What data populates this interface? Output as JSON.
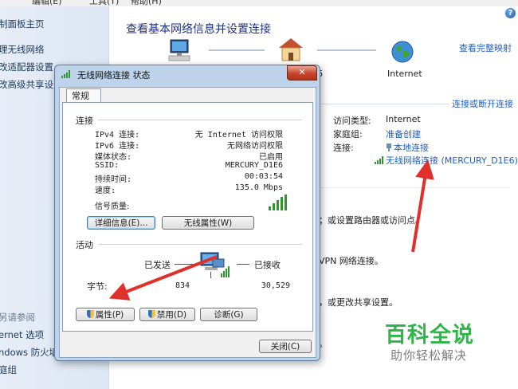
{
  "menubar": {
    "items": [
      "编辑(E)",
      "工具(T)",
      "帮助(H)"
    ]
  },
  "sidebar": {
    "items": [
      "制面板主页",
      "理无线网络",
      "改适配器设置",
      "改高级共享设置"
    ],
    "see_also_title": "另请参阅",
    "see_also": [
      "ernet 选项",
      "ndows 防火墙",
      "庭组"
    ]
  },
  "main": {
    "title": "查看基本网络信息并设置连接",
    "full_map": "查看完整映射",
    "internet_label": "Internet",
    "ipv6_fragment": "6",
    "connect_disconnect": "连接或断开连接",
    "access_type_label": "访问类型:",
    "access_type_value": "Internet",
    "homegroup_label": "家庭组:",
    "homegroup_value": "准备创建",
    "connections_label": "连接:",
    "connection_local": "本地连接",
    "connection_wifi": "无线网络连接 (MERCURY_D1E6)",
    "text_router": "；或设置路由器或访问点。",
    "text_vpn": "VPN 网络连接。",
    "text_share": "，或更改共享设置。",
    "text_dot": "。"
  },
  "dialog": {
    "title": "无线网络连接 状态",
    "close_glyph": "✕",
    "tab_general": "常规",
    "group_connection": "连接",
    "rows": [
      {
        "label": "IPv4 连接:",
        "value": "无 Internet 访问权限"
      },
      {
        "label": "IPv6 连接:",
        "value": "无网络访问权限"
      },
      {
        "label": "媒体状态:",
        "value": "已启用"
      },
      {
        "label": "SSID:",
        "value": "MERCURY_D1E6"
      },
      {
        "label": "持续时间:",
        "value": "00:03:54"
      },
      {
        "label": "速度:",
        "value": "135.0 Mbps"
      }
    ],
    "signal_label": "信号质量:",
    "details_button": "详细信息(E)...",
    "wireless_props_button": "无线属性(W)",
    "group_activity": "活动",
    "sent_label": "已发送",
    "received_label": "已接收",
    "bytes_label": "字节:",
    "bytes_sent": "834",
    "bytes_received": "30,529",
    "properties_button": "属性(P)",
    "disable_button": "禁用(D)",
    "diagnose_button": "诊断(G)",
    "close_button": "关闭(C)"
  },
  "watermark": {
    "line1": "百科全说",
    "line2": "助你轻松解决"
  },
  "colors": {
    "link": "#1d5fc7",
    "title": "#1e3287",
    "arrow": "#e0302c",
    "watermark": "#2fb54a"
  }
}
